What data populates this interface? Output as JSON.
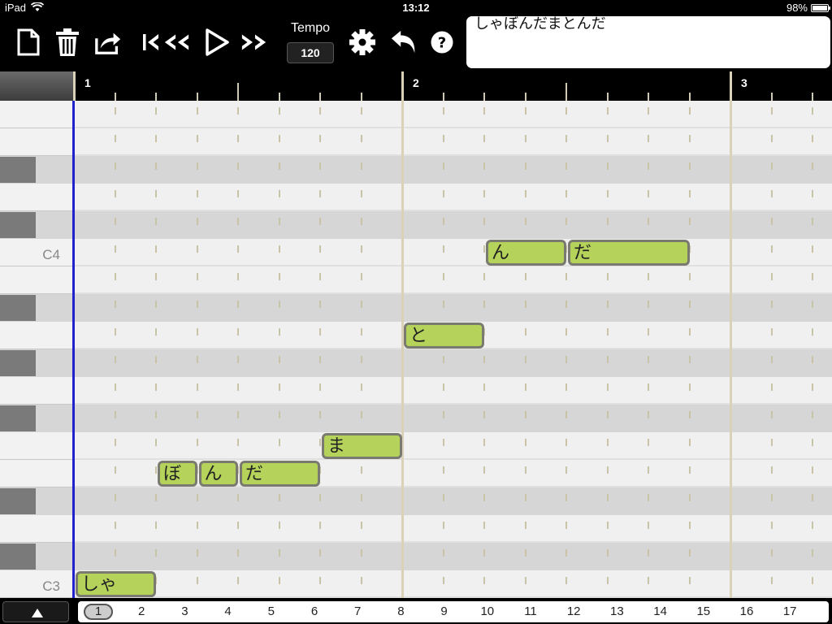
{
  "status_bar": {
    "device": "iPad",
    "time": "13:12",
    "battery": "98%",
    "battery_level": 0.98
  },
  "toolbar": {
    "icons": [
      "new-document-icon",
      "trash-icon",
      "share-icon",
      "skip-to-start-icon",
      "rewind-icon",
      "play-icon",
      "fast-forward-icon",
      "settings-gear-icon",
      "undo-icon",
      "help-icon"
    ],
    "tempo_label": "Tempo",
    "tempo_value": "120",
    "lyrics": "しゃぼんだまとんだ"
  },
  "ruler": {
    "bars": [
      "1",
      "2",
      "3"
    ]
  },
  "piano": {
    "labels": {
      "c4": "C4",
      "c3": "C3"
    }
  },
  "notes": [
    {
      "text": "しゃ",
      "pitch": "C3",
      "start": 0,
      "length": 2
    },
    {
      "text": "ぼ",
      "pitch": "E3",
      "start": 2,
      "length": 1
    },
    {
      "text": "ん",
      "pitch": "E3",
      "start": 3,
      "length": 1
    },
    {
      "text": "だ",
      "pitch": "E3",
      "start": 4,
      "length": 2
    },
    {
      "text": "ま",
      "pitch": "F3",
      "start": 6,
      "length": 2
    },
    {
      "text": "と",
      "pitch": "A3",
      "start": 8,
      "length": 2
    },
    {
      "text": "ん",
      "pitch": "C4",
      "start": 10,
      "length": 2
    },
    {
      "text": "だ",
      "pitch": "C4",
      "start": 12,
      "length": 3
    }
  ],
  "pager": {
    "pages": [
      "1",
      "2",
      "3",
      "4",
      "5",
      "6",
      "7",
      "8",
      "9",
      "10",
      "11",
      "12",
      "13",
      "14",
      "15",
      "16",
      "17"
    ],
    "current": "1"
  },
  "colors": {
    "note_fill": "#b5d35a",
    "playhead": "#2222cc",
    "black_key": "#7a7a7a"
  }
}
